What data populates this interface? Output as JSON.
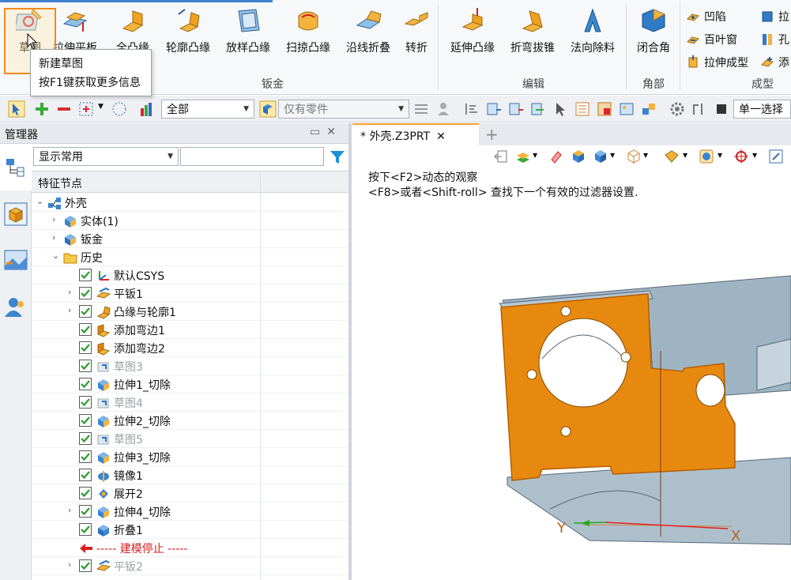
{
  "ribbon": {
    "buttons": [
      {
        "id": "sketch",
        "label": "草图"
      },
      {
        "id": "extrude_plate",
        "label": "拉伸平板"
      },
      {
        "id": "full_flange",
        "label": "全凸缘"
      },
      {
        "id": "contour_flange",
        "label": "轮廓凸缘"
      },
      {
        "id": "lofted_flange",
        "label": "放样凸缘"
      },
      {
        "id": "sweep_flange",
        "label": "扫掠凸缘"
      },
      {
        "id": "line_fold",
        "label": "沿线折叠"
      },
      {
        "id": "jog",
        "label": "转折"
      },
      {
        "id": "extend_flange",
        "label": "延伸凸缘"
      },
      {
        "id": "bend_draft",
        "label": "折弯拔锥"
      },
      {
        "id": "normal_cut",
        "label": "法向除料"
      },
      {
        "id": "closed_corner",
        "label": "闭合角"
      }
    ],
    "small_buttons": [
      {
        "id": "dimple",
        "label": "凹陷"
      },
      {
        "id": "louver",
        "label": "百叶窗"
      },
      {
        "id": "extrude_form",
        "label": "拉伸成型"
      },
      {
        "id": "stretch",
        "label": "拉"
      },
      {
        "id": "hole",
        "label": "孔"
      },
      {
        "id": "add",
        "label": "添"
      }
    ],
    "groups": {
      "sheet_metal": "钣金",
      "edit": "编辑",
      "corner": "角部",
      "form": "成型"
    }
  },
  "tooltip": {
    "title": "新建草图",
    "hint": "按F1键获取更多信息"
  },
  "toolbar": {
    "filter_all": "全部",
    "parts_only": "仅有零件",
    "selection_mode": "单一选择"
  },
  "manager": {
    "title": "管理器",
    "display_filter": "显示常用",
    "column_header": "特征节点",
    "tree": [
      {
        "label": "外壳",
        "level": 0,
        "expand": "open",
        "check": false,
        "icon": "assembly-icon",
        "style": "normal"
      },
      {
        "label": "实体(1)",
        "level": 1,
        "expand": "closed",
        "check": false,
        "icon": "solid-icon",
        "style": "normal"
      },
      {
        "label": "钣金",
        "level": 1,
        "expand": "closed",
        "check": false,
        "icon": "sheetmetal-icon",
        "style": "normal"
      },
      {
        "label": "历史",
        "level": 1,
        "expand": "open",
        "check": false,
        "icon": "folder-icon",
        "style": "normal"
      },
      {
        "label": "默认CSYS",
        "level": 2,
        "expand": "none",
        "check": true,
        "icon": "csys-icon",
        "style": "normal"
      },
      {
        "label": "平钣1",
        "level": 2,
        "expand": "closed",
        "check": true,
        "icon": "flat-plate-icon",
        "style": "normal"
      },
      {
        "label": "凸缘与轮廓1",
        "level": 2,
        "expand": "closed",
        "check": true,
        "icon": "flange-icon",
        "style": "normal"
      },
      {
        "label": "添加弯边1",
        "level": 2,
        "expand": "none",
        "check": true,
        "icon": "bend-icon",
        "style": "normal"
      },
      {
        "label": "添加弯边2",
        "level": 2,
        "expand": "none",
        "check": true,
        "icon": "bend-icon",
        "style": "normal"
      },
      {
        "label": "草图3",
        "level": 2,
        "expand": "none",
        "check": true,
        "icon": "sketch-icon",
        "style": "dim"
      },
      {
        "label": "拉伸1_切除",
        "level": 2,
        "expand": "none",
        "check": true,
        "icon": "extrude-cut-icon",
        "style": "normal"
      },
      {
        "label": "草图4",
        "level": 2,
        "expand": "none",
        "check": true,
        "icon": "sketch-icon",
        "style": "dim"
      },
      {
        "label": "拉伸2_切除",
        "level": 2,
        "expand": "none",
        "check": true,
        "icon": "extrude-cut-icon",
        "style": "normal"
      },
      {
        "label": "草图5",
        "level": 2,
        "expand": "none",
        "check": true,
        "icon": "sketch-icon",
        "style": "dim"
      },
      {
        "label": "拉伸3_切除",
        "level": 2,
        "expand": "none",
        "check": true,
        "icon": "extrude-cut-icon",
        "style": "normal"
      },
      {
        "label": "镜像1",
        "level": 2,
        "expand": "none",
        "check": true,
        "icon": "mirror-icon",
        "style": "normal"
      },
      {
        "label": "展开2",
        "level": 2,
        "expand": "none",
        "check": true,
        "icon": "unfold-icon",
        "style": "normal"
      },
      {
        "label": "拉伸4_切除",
        "level": 2,
        "expand": "closed",
        "check": true,
        "icon": "extrude-cut-icon",
        "style": "normal"
      },
      {
        "label": "折叠1",
        "level": 2,
        "expand": "none",
        "check": true,
        "icon": "fold-icon",
        "style": "normal"
      },
      {
        "label": "----- 建模停止 -----",
        "level": 2,
        "expand": "none",
        "check": false,
        "icon": "stop-arrow-icon",
        "style": "red"
      },
      {
        "label": "平钣2",
        "level": 2,
        "expand": "closed",
        "check": true,
        "icon": "flat-plate-icon",
        "style": "dim"
      }
    ]
  },
  "document": {
    "tab_label": "* 外壳.Z3PRT",
    "hint_line1": "按下<F2>动态的观察",
    "hint_line2": "<F8>或者<Shift-roll> 查找下一个有效的过滤器设置.",
    "axis_y": "Y",
    "axis_x": "X"
  },
  "colors": {
    "accent": "#f08a1c",
    "selected_face": "#e8890f",
    "part_body": "#9fb4c3",
    "check_green": "#2a9d2a"
  }
}
